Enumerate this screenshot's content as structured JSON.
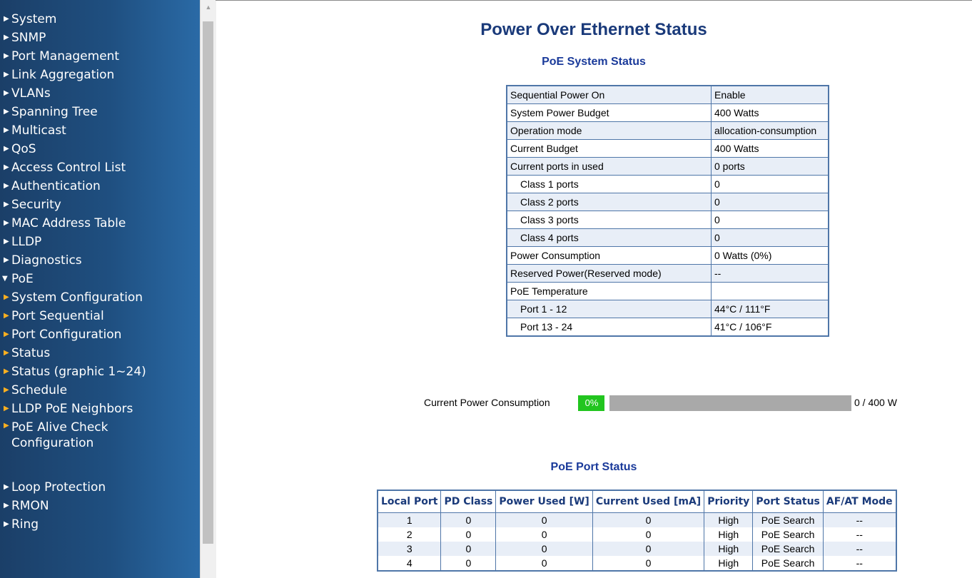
{
  "sidebar": {
    "items": [
      {
        "label": "System"
      },
      {
        "label": "SNMP"
      },
      {
        "label": "Port Management"
      },
      {
        "label": "Link Aggregation"
      },
      {
        "label": "VLANs"
      },
      {
        "label": "Spanning Tree"
      },
      {
        "label": "Multicast"
      },
      {
        "label": "QoS"
      },
      {
        "label": "Access Control List"
      },
      {
        "label": "Authentication"
      },
      {
        "label": "Security"
      },
      {
        "label": "MAC Address Table"
      },
      {
        "label": "LLDP"
      },
      {
        "label": "Diagnostics"
      },
      {
        "label": "PoE"
      }
    ],
    "poe_sub": [
      {
        "label": "System Configuration"
      },
      {
        "label": "Port Sequential"
      },
      {
        "label": "Port Configuration"
      },
      {
        "label": "Status"
      },
      {
        "label": "Status (graphic 1~24)"
      },
      {
        "label": "Schedule"
      },
      {
        "label": "LLDP PoE Neighbors"
      },
      {
        "label": "PoE Alive Check Configuration"
      }
    ],
    "bottom_items": [
      {
        "label": "Loop Protection"
      },
      {
        "label": "RMON"
      },
      {
        "label": "Ring"
      }
    ]
  },
  "main": {
    "title": "Power Over Ethernet Status",
    "system_status": {
      "title": "PoE System Status",
      "rows": [
        {
          "key": "Sequential Power On",
          "value": "Enable"
        },
        {
          "key": "System Power Budget",
          "value": "400 Watts"
        },
        {
          "key": "Operation mode",
          "value": "allocation-consumption"
        },
        {
          "key": "Current Budget",
          "value": "400 Watts"
        },
        {
          "key": "Current ports in used",
          "value": "0 ports"
        },
        {
          "key": "Class 1 ports",
          "value": "0"
        },
        {
          "key": "Class 2 ports",
          "value": "0"
        },
        {
          "key": "Class 3 ports",
          "value": "0"
        },
        {
          "key": "Class 4 ports",
          "value": "0"
        },
        {
          "key": "Power Consumption",
          "value": "0 Watts (0%)"
        },
        {
          "key": "Reserved Power(Reserved mode)",
          "value": "--"
        },
        {
          "key": "PoE Temperature",
          "value": ""
        },
        {
          "key": "Port 1 - 12",
          "value": "44°C / 111°F"
        },
        {
          "key": "Port 13 - 24",
          "value": "41°C / 106°F"
        }
      ]
    },
    "power": {
      "label": "Current Power Consumption",
      "percent_label": "0%",
      "fraction": 0,
      "total": "0 / 400 W",
      "fill_color": "#22c51f",
      "bar_color": "#a9a9a9"
    },
    "port_status": {
      "title": "PoE Port Status",
      "headers": [
        "Local Port",
        "PD Class",
        "Power Used [W]",
        "Current Used [mA]",
        "Priority",
        "Port Status",
        "AF/AT Mode"
      ],
      "rows": [
        [
          "1",
          "0",
          "0",
          "0",
          "High",
          "PoE Search",
          "--"
        ],
        [
          "2",
          "0",
          "0",
          "0",
          "High",
          "PoE Search",
          "--"
        ],
        [
          "3",
          "0",
          "0",
          "0",
          "High",
          "PoE Search",
          "--"
        ],
        [
          "4",
          "0",
          "0",
          "0",
          "High",
          "PoE Search",
          "--"
        ]
      ]
    }
  },
  "colors": {
    "heading": "#1a3a7a",
    "table_border": "#4f76a8",
    "row_alt": "#e8eef7",
    "sidebar_bg": "#1f4f80",
    "sub_arrow": "#ffb020"
  }
}
